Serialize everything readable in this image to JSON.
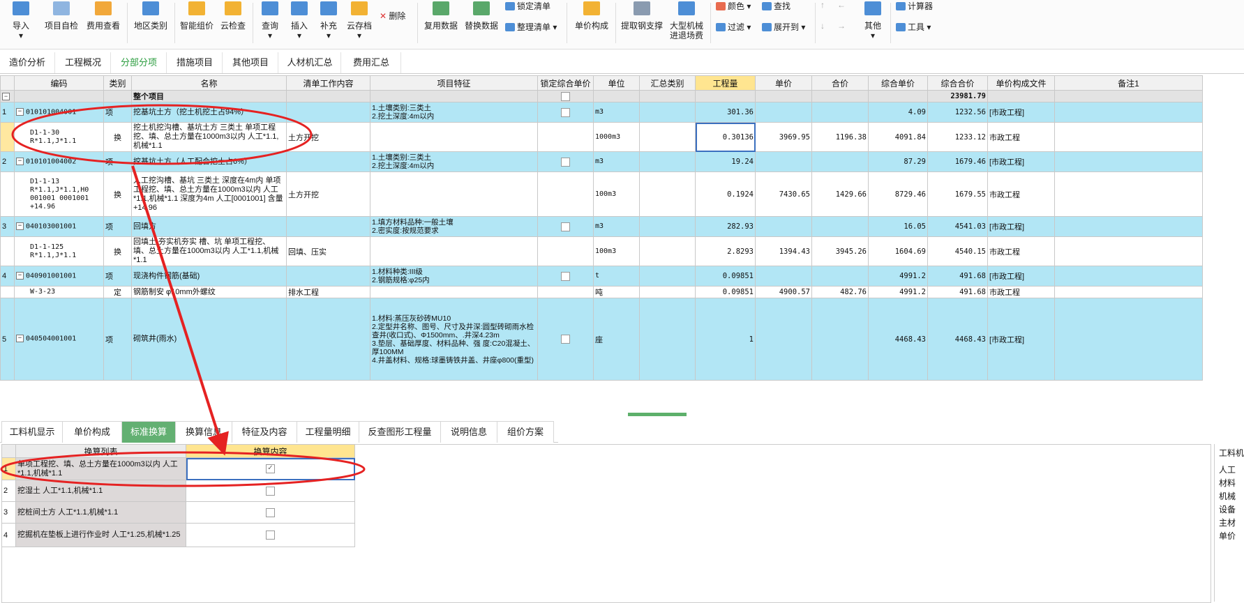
{
  "toolbar": {
    "import": "导入",
    "self_check": "项目自检",
    "fee_view": "费用查看",
    "region": "地区类别",
    "smart_pricing": "智能组价",
    "cloud_check": "云检查",
    "query": "查询",
    "insert": "插入",
    "supplement": "补充",
    "cloud_save": "云存档",
    "delete": "删除",
    "reuse_data": "复用数据",
    "replace_data": "替换数据",
    "lock_list": "锁定清单",
    "organize_list": "整理清单",
    "unit_price_comp": "单价构成",
    "extract_support": "提取钢支撑",
    "large_machine_1": "大型机械",
    "large_machine_2": "进退场费",
    "color": "颜色",
    "find": "查找",
    "filter": "过滤",
    "expand_to": "展开到",
    "other": "其他",
    "calculator": "计算器",
    "tools": "工具"
  },
  "main_tabs": [
    "造价分析",
    "工程概况",
    "分部分项",
    "措施项目",
    "其他项目",
    "人材机汇总",
    "费用汇总"
  ],
  "columns": [
    "编码",
    "类别",
    "名称",
    "清单工作内容",
    "项目特征",
    "锁定综合单价",
    "单位",
    "汇总类别",
    "工程量",
    "单价",
    "合价",
    "综合单价",
    "综合合价",
    "单价构成文件",
    "备注1"
  ],
  "rows": {
    "r0": {
      "name": "整个项目",
      "total": "23981.79"
    },
    "r1": {
      "idx": "1",
      "code": "010101004001",
      "type": "项",
      "name": "挖基坑土方（挖土机挖土占94%）",
      "feat": "1.土壤类别:三类土\n2.挖土深度:4m以内",
      "unit": "m3",
      "qty": "301.36",
      "price": "",
      "amount": "",
      "cuprice": "4.09",
      "cuamount": "1232.56",
      "file": "[市政工程]"
    },
    "r2": {
      "idx": "",
      "code": "D1-1-30\nR*1.1,J*1.1",
      "type": "换",
      "name": "挖土机挖沟槽、基坑土方 三类土  单项工程挖、填、总土方量在1000m3以内 人工*1.1,机械*1.1",
      "work": "土方开挖",
      "unit": "1000m3",
      "qty": "0.30136",
      "price": "3969.95",
      "amount": "1196.38",
      "cuprice": "4091.84",
      "cuamount": "1233.12",
      "file": "市政工程"
    },
    "r3": {
      "idx": "2",
      "code": "010101004002",
      "type": "项",
      "name": "挖基坑土方（人工配合挖土占6%）",
      "feat": "1.土壤类别:三类土\n2.挖土深度:4m以内",
      "unit": "m3",
      "qty": "19.24",
      "cuprice": "87.29",
      "cuamount": "1679.46",
      "file": "[市政工程]"
    },
    "r4": {
      "code": "D1-1-13\nR*1.1,J*1.1,H0\n001001 0001001\n+14.96",
      "type": "换",
      "name": "人工挖沟槽、基坑 三类土 深度在4m内 单项工程挖、填、总土方量在1000m3以内 人工*1.1,机械*1.1  深度为4m 人工[0001001] 含量+14.96",
      "work": "土方开挖",
      "unit": "100m3",
      "qty": "0.1924",
      "price": "7430.65",
      "amount": "1429.66",
      "cuprice": "8729.46",
      "cuamount": "1679.55",
      "file": "市政工程"
    },
    "r5": {
      "idx": "3",
      "code": "040103001001",
      "type": "项",
      "name": "回填方",
      "feat": "1.填方材料品种:一般土壤\n2.密实度:按规范要求",
      "unit": "m3",
      "qty": "282.93",
      "cuprice": "16.05",
      "cuamount": "4541.03",
      "file": "[市政工程]"
    },
    "r6": {
      "code": "D1-1-125\nR*1.1,J*1.1",
      "type": "换",
      "name": "回填土 夯实机夯实 槽、坑  单项工程挖、填、总土方量在1000m3以内 人工*1.1,机械*1.1",
      "work": "回填、压实",
      "unit": "100m3",
      "qty": "2.8293",
      "price": "1394.43",
      "amount": "3945.26",
      "cuprice": "1604.69",
      "cuamount": "4540.15",
      "file": "市政工程"
    },
    "r7": {
      "idx": "4",
      "code": "040901001001",
      "type": "项",
      "name": "现浇构件钢筋(基础)",
      "feat": "1.材料种类:III级\n2.钢筋规格:φ25内",
      "unit": "t",
      "qty": "0.09851",
      "cuprice": "4991.2",
      "cuamount": "491.68",
      "file": "[市政工程]"
    },
    "r8": {
      "code": "W-3-23",
      "type": "定",
      "name": "钢筋制安 φ10mm外螺纹",
      "work": "排水工程",
      "unit": "吨",
      "qty": "0.09851",
      "price": "4900.57",
      "amount": "482.76",
      "cuprice": "4991.2",
      "cuamount": "491.68",
      "file": "市政工程"
    },
    "r9": {
      "idx": "5",
      "code": "040504001001",
      "type": "项",
      "name": "砌筑井(雨水)",
      "feat": "1.材料:蒸压灰砂砖MU10\n2.定型井名称、图号、尺寸及井深:圆型砖砌雨水检查井(收口式)、Φ1500mm、.井深4.23m\n3.垫层、基础厚度、材料品种、强 度:C20混凝土、厚100MM\n4.井盖材料、规格:球墨铸铁井盖、井座φ800(重型)",
      "unit": "座",
      "qty": "1",
      "cuprice": "4468.43",
      "cuamount": "4468.43",
      "file": "[市政工程]"
    }
  },
  "bottom_tabs": [
    "工料机显示",
    "单价构成",
    "标准换算",
    "换算信息",
    "特征及内容",
    "工程量明细",
    "反查图形工程量",
    "说明信息",
    "组价方案"
  ],
  "sub": {
    "col_list": "换算列表",
    "col_content": "换算内容",
    "items": [
      {
        "idx": "1",
        "label": "单项工程挖、填、总土方量在1000m3以内 人工*1.1,机械*1.1",
        "checked": true
      },
      {
        "idx": "2",
        "label": "挖湿土 人工*1.1,机械*1.1",
        "checked": false
      },
      {
        "idx": "3",
        "label": "挖桩间土方 人工*1.1,机械*1.1",
        "checked": false
      },
      {
        "idx": "4",
        "label": "挖掘机在垫板上进行作业时 人工*1.25,机械*1.25",
        "checked": false
      }
    ]
  },
  "right_panel": [
    "工料机",
    "人工",
    "材料",
    "机械",
    "设备",
    "主材",
    "单价"
  ],
  "colors": {
    "accent": "#2a9c3e",
    "row_blue": "#b2e6f5",
    "highlight": "#ffe590",
    "annotation": "#e52222"
  }
}
